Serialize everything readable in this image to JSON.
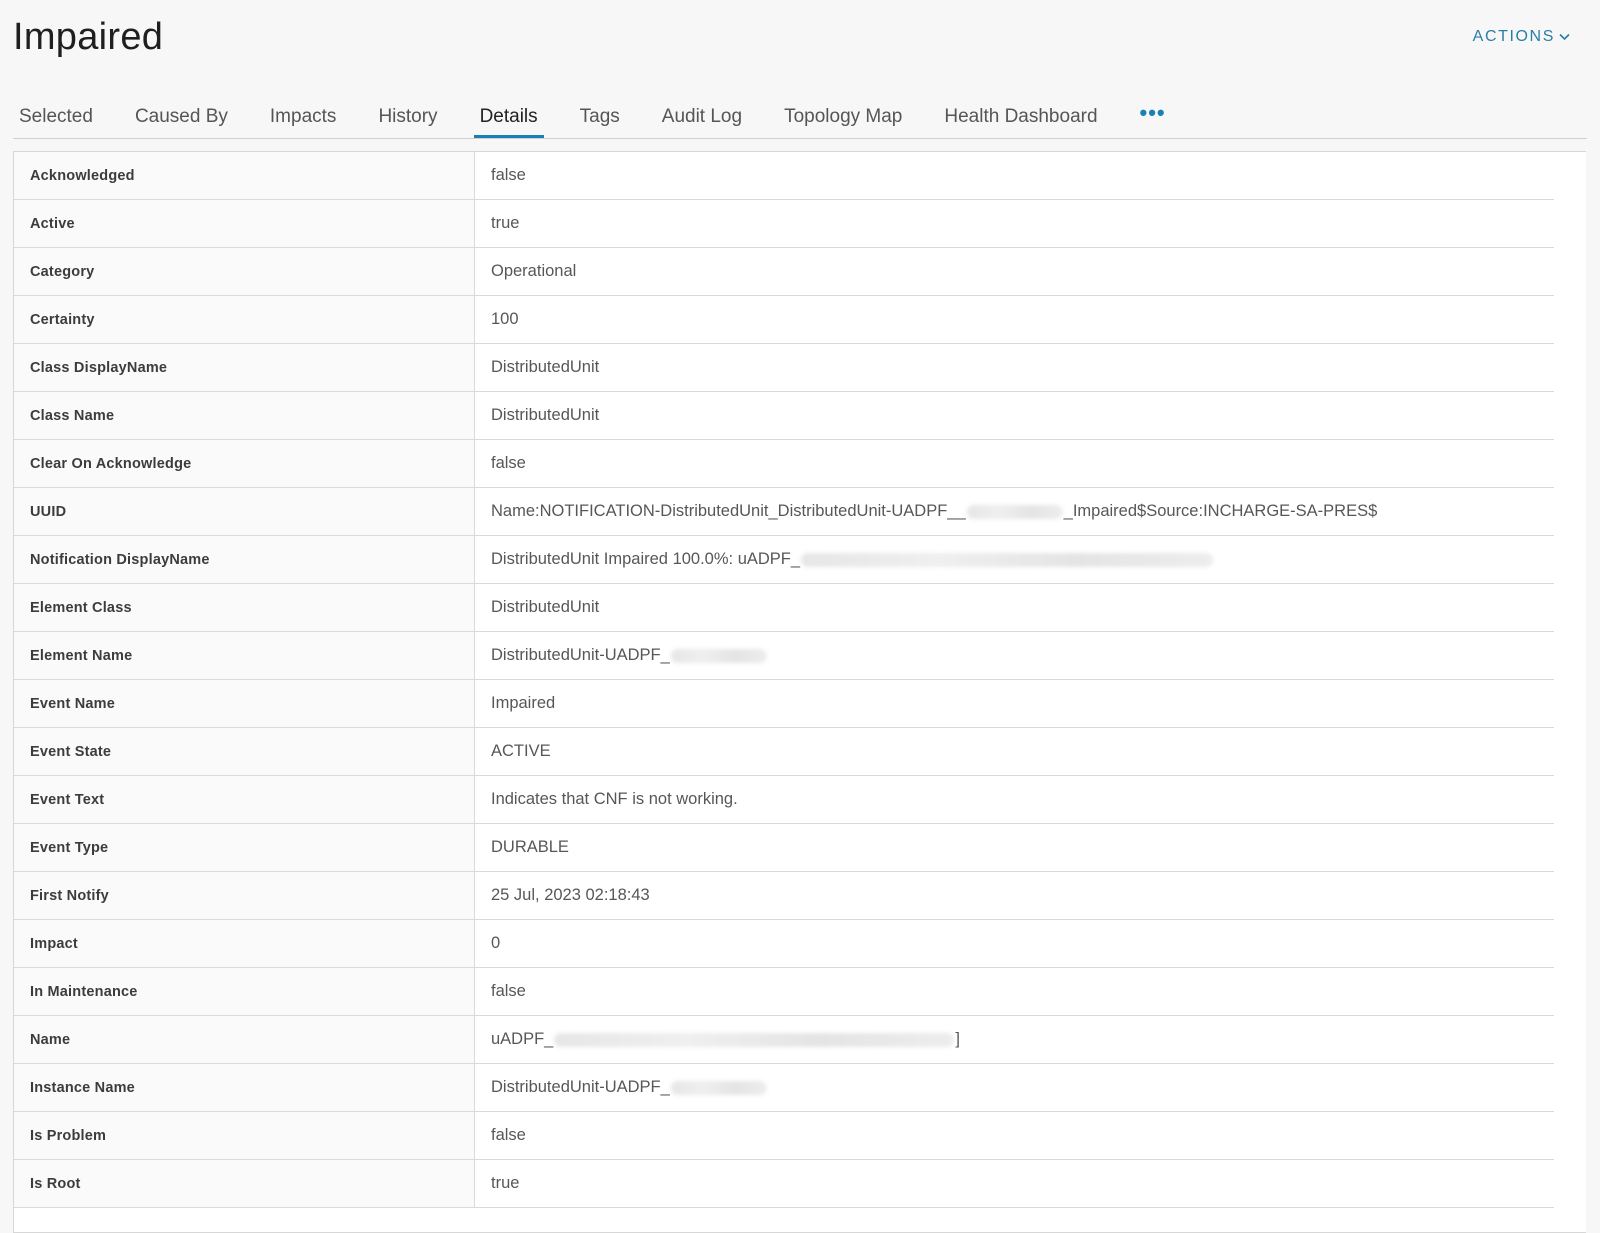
{
  "header": {
    "title": "Impaired",
    "actions_label": "ACTIONS",
    "actions_icon": "chevron-down-icon"
  },
  "tabs": [
    {
      "label": "Selected",
      "active": false
    },
    {
      "label": "Caused By",
      "active": false
    },
    {
      "label": "Impacts",
      "active": false
    },
    {
      "label": "History",
      "active": false
    },
    {
      "label": "Details",
      "active": true
    },
    {
      "label": "Tags",
      "active": false
    },
    {
      "label": "Audit Log",
      "active": false
    },
    {
      "label": "Topology Map",
      "active": false
    },
    {
      "label": "Health Dashboard",
      "active": false
    }
  ],
  "tabs_more": "•••",
  "details": [
    {
      "name": "Acknowledged",
      "value": "false"
    },
    {
      "name": "Active",
      "value": "true"
    },
    {
      "name": "Category",
      "value": "Operational"
    },
    {
      "name": "Certainty",
      "value": "100"
    },
    {
      "name": "Class DisplayName",
      "value": "DistributedUnit"
    },
    {
      "name": "Class Name",
      "value": "DistributedUnit"
    },
    {
      "name": "Clear On Acknowledge",
      "value": "false"
    },
    {
      "name": "UUID",
      "value_prefix": "Name:NOTIFICATION-DistributedUnit_DistributedUnit-UADPF__",
      "value_suffix": "_Impaired$Source:INCHARGE-SA-PRES$"
    },
    {
      "name": "Notification DisplayName",
      "value_prefix": "DistributedUnit Impaired 100.0%: uADPF_",
      "value_suffix": ""
    },
    {
      "name": "Element Class",
      "value": "DistributedUnit"
    },
    {
      "name": "Element Name",
      "value_prefix": "DistributedUnit-UADPF_",
      "value_suffix": ""
    },
    {
      "name": "Event Name",
      "value": "Impaired"
    },
    {
      "name": "Event State",
      "value": "ACTIVE"
    },
    {
      "name": "Event Text",
      "value": "Indicates that CNF is not working."
    },
    {
      "name": "Event Type",
      "value": "DURABLE"
    },
    {
      "name": "First Notify",
      "value": "25 Jul, 2023 02:18:43"
    },
    {
      "name": "Impact",
      "value": "0"
    },
    {
      "name": "In Maintenance",
      "value": "false"
    },
    {
      "name": "Name",
      "value_prefix": "uADPF_",
      "value_suffix": "]"
    },
    {
      "name": "Instance Name",
      "value_prefix": "DistributedUnit-UADPF_",
      "value_suffix": ""
    },
    {
      "name": "Is Problem",
      "value": "false"
    },
    {
      "name": "Is Root",
      "value": "true"
    }
  ],
  "colors": {
    "accent": "#1a7fb3",
    "actions": "#2a7ea6",
    "background": "#f7f7f7"
  }
}
